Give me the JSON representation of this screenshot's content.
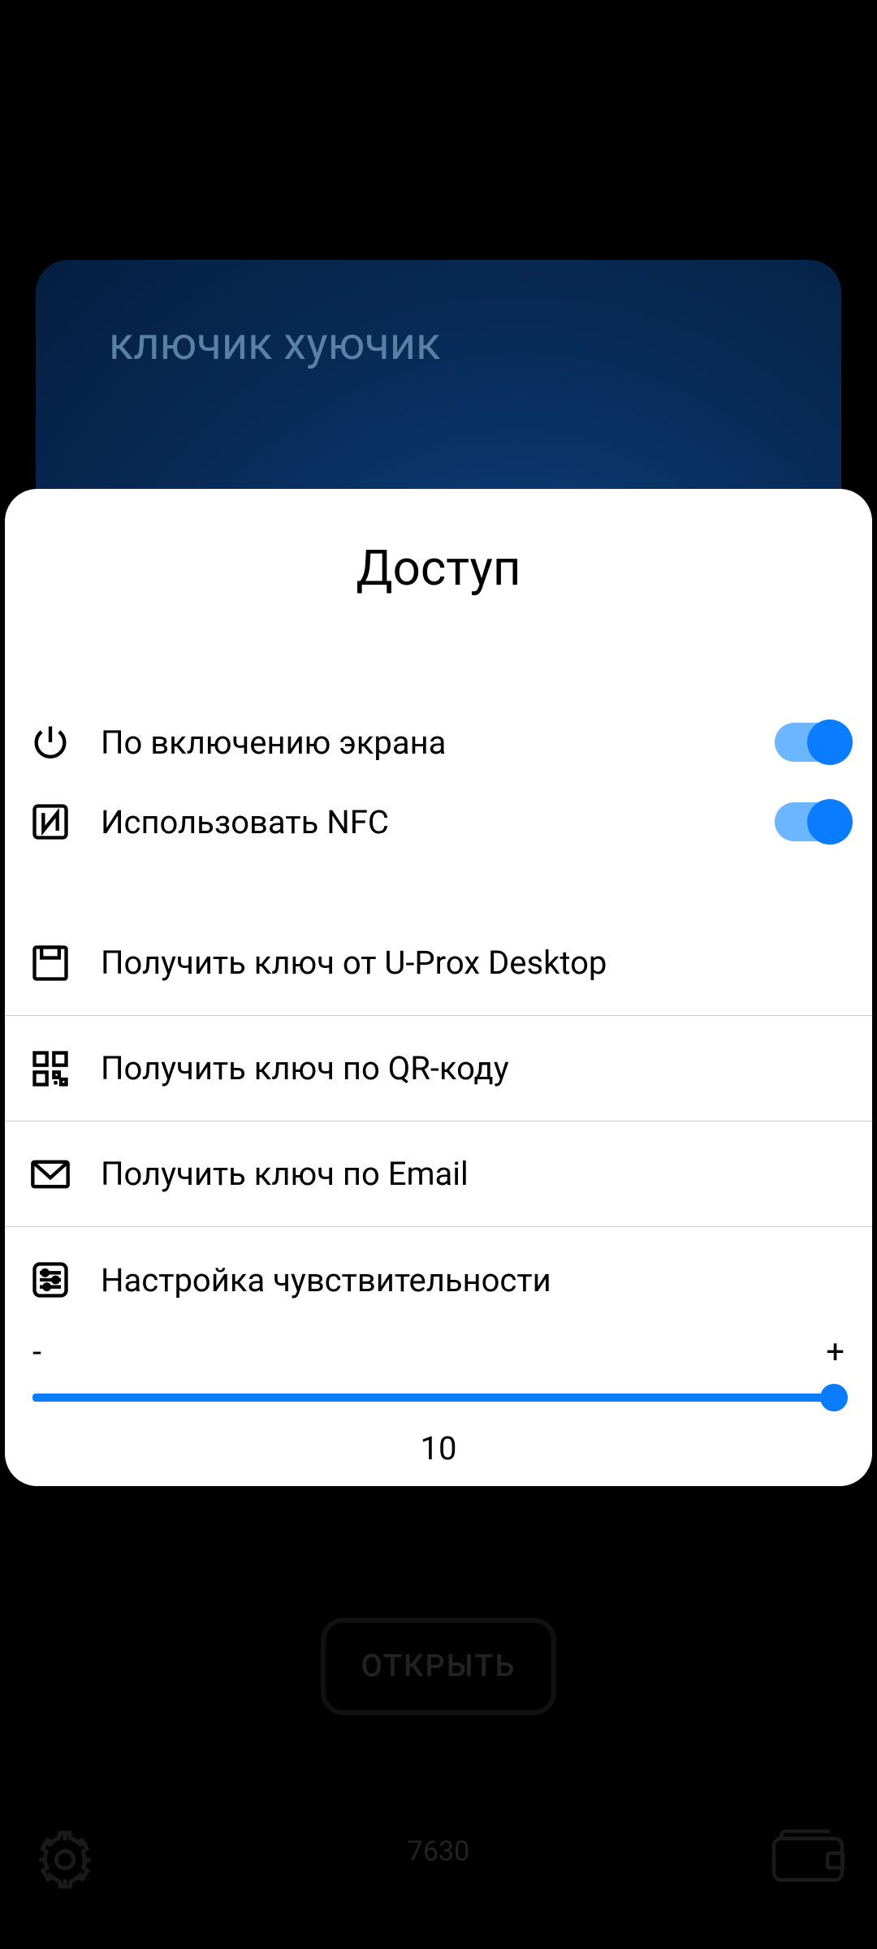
{
  "card": {
    "title": "ключик хуючик"
  },
  "open_button": "ОТКРЫТЬ",
  "bottom_number": "7630",
  "sheet": {
    "title": "Доступ",
    "toggles": [
      {
        "label": "По включению экрана",
        "on": true
      },
      {
        "label": "Использовать NFC",
        "on": true
      }
    ],
    "items": [
      {
        "label": "Получить ключ от U-Prox Desktop"
      },
      {
        "label": "Получить ключ по QR-коду"
      },
      {
        "label": "Получить ключ по Email"
      }
    ],
    "sensitivity": {
      "label": "Настройка чувствительности",
      "minus": "-",
      "plus": "+",
      "value": "10"
    }
  }
}
